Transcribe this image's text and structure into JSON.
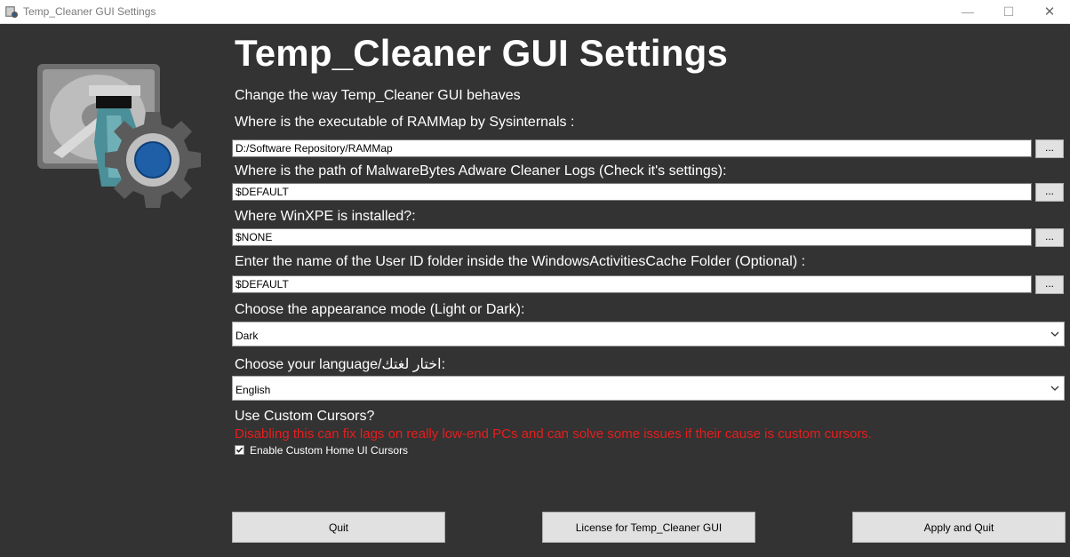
{
  "window": {
    "title": "Temp_Cleaner GUI Settings",
    "minimize_glyph": "—",
    "maximize_glyph": "☐",
    "close_glyph": "✕"
  },
  "header": {
    "heading": "Temp_Cleaner GUI Settings",
    "subtitle": "Change the way Temp_Cleaner GUI behaves"
  },
  "settings": {
    "rammap": {
      "label": "Where is the executable of RAMMap by Sysinternals :",
      "value": "D:/Software Repository/RAMMap",
      "browse_label": "..."
    },
    "adwcleaner": {
      "label": "Where is the path of MalwareBytes Adware Cleaner Logs (Check it's settings):",
      "value": "$DEFAULT",
      "browse_label": "..."
    },
    "winxpe": {
      "label": "Where WinXPE is installed?:",
      "value": "$NONE",
      "browse_label": "..."
    },
    "userid": {
      "label": "Enter the name of the User ID folder inside the WindowsActivitiesCache Folder (Optional) :",
      "value": "$DEFAULT",
      "browse_label": "..."
    },
    "appearance": {
      "label": "Choose the appearance mode (Light or Dark):",
      "selected": "Dark"
    },
    "language": {
      "label": "Choose your language/اختار لغتك:",
      "selected": "English"
    },
    "cursors": {
      "label": "Use Custom Cursors?",
      "warning": "Disabling this can fix lags on really low-end PCs and can solve some issues if their cause is custom cursors.",
      "checkbox_label": "Enable Custom Home UI Cursors",
      "checked": true
    }
  },
  "buttons": {
    "quit": "Quit",
    "license": "License for Temp_Cleaner GUI",
    "apply": "Apply and Quit"
  },
  "icons": {
    "app": "app-icon",
    "logo": "hdd-cleaner-gear-logo",
    "chevron": "chevron-down-icon",
    "check": "check-icon"
  },
  "colors": {
    "background": "#333333",
    "warning": "#e51e1e",
    "text": "#ffffff",
    "button": "#e1e1e1"
  }
}
